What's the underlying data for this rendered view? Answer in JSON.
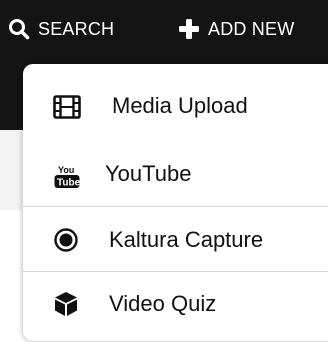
{
  "topbar": {
    "search_label": "SEARCH",
    "search_icon": "search-icon",
    "add_new_label": "ADD NEW",
    "add_icon": "plus-icon"
  },
  "menu": {
    "items": [
      {
        "label": "Media Upload",
        "icon": "film-icon"
      },
      {
        "label": "YouTube",
        "icon": "youtube-icon"
      },
      {
        "label": "Kaltura Capture",
        "icon": "record-icon"
      },
      {
        "label": "Video Quiz",
        "icon": "cube-icon"
      }
    ]
  },
  "colors": {
    "topbar_bg": "#141414",
    "menu_text": "#111111",
    "divider": "#d6d6d6"
  }
}
